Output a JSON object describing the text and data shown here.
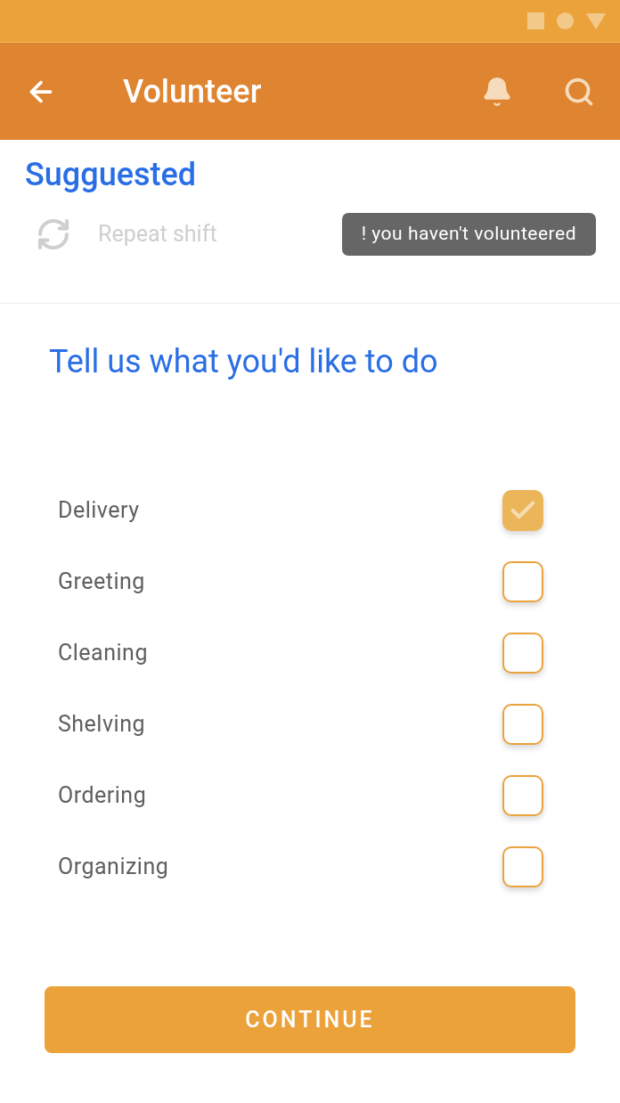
{
  "app_bar": {
    "title": "Volunteer"
  },
  "suggested": {
    "title": "Sugguested",
    "repeat_label": "Repeat shift",
    "notice": "! you haven't volunteered"
  },
  "form": {
    "heading": "Tell us what you'd like to do",
    "options": [
      {
        "label": "Delivery",
        "checked": true
      },
      {
        "label": "Greeting",
        "checked": false
      },
      {
        "label": "Cleaning",
        "checked": false
      },
      {
        "label": "Shelving",
        "checked": false
      },
      {
        "label": "Ordering",
        "checked": false
      },
      {
        "label": "Organizing",
        "checked": false
      }
    ]
  },
  "continue_button": "CONTINUE"
}
